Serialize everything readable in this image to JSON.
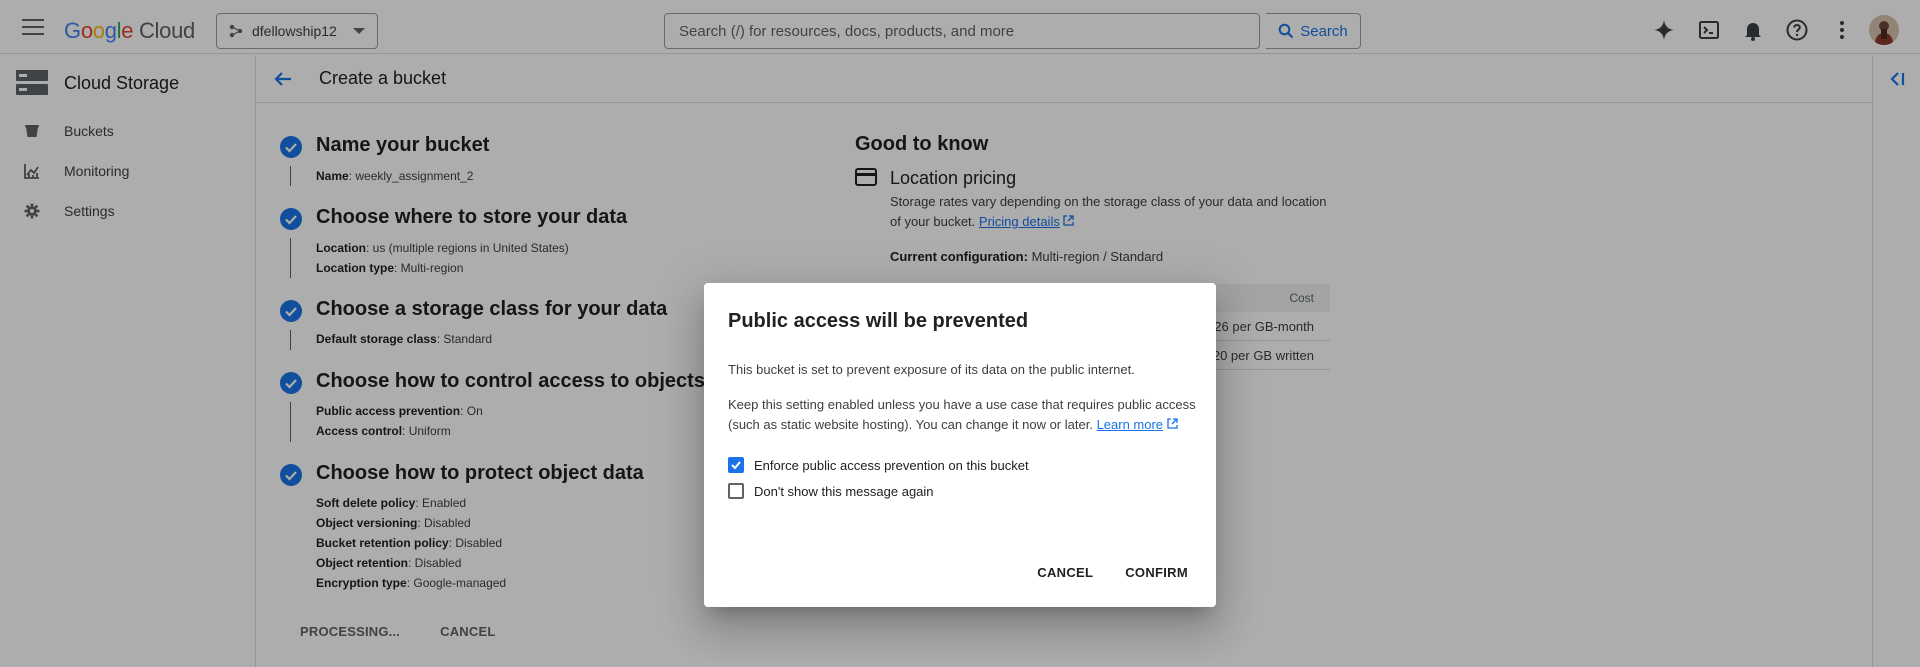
{
  "topbar": {
    "logo": {
      "g1": "G",
      "g2": "o",
      "g3": "o",
      "g4": "g",
      "g5": "l",
      "g6": "e",
      "cloud": "Cloud"
    },
    "project": "dfellowship12",
    "search_placeholder": "Search (/) for resources, docs, products, and more",
    "search_button": "Search",
    "icons": [
      "gemini-icon",
      "cloud-shell-icon",
      "notifications-icon",
      "help-icon",
      "more-vert-icon"
    ]
  },
  "nav": {
    "product_title": "Cloud Storage",
    "items": [
      {
        "label": "Buckets",
        "icon": "bucket-icon"
      },
      {
        "label": "Monitoring",
        "icon": "monitoring-icon"
      },
      {
        "label": "Settings",
        "icon": "gear-icon"
      }
    ]
  },
  "page": {
    "title": "Create a bucket"
  },
  "steps": [
    {
      "title": "Name your bucket",
      "details": [
        {
          "k": "Name",
          "v": ": weekly_assignment_2"
        }
      ]
    },
    {
      "title": "Choose where to store your data",
      "details": [
        {
          "k": "Location",
          "v": ": us (multiple regions in United States)"
        },
        {
          "k": "Location type",
          "v": ": Multi-region"
        }
      ]
    },
    {
      "title": "Choose a storage class for your data",
      "details": [
        {
          "k": "Default storage class",
          "v": ": Standard"
        }
      ]
    },
    {
      "title": "Choose how to control access to objects",
      "details": [
        {
          "k": "Public access prevention",
          "v": ": On"
        },
        {
          "k": "Access control",
          "v": ": Uniform"
        }
      ]
    },
    {
      "title": "Choose how to protect object data",
      "details": [
        {
          "k": "Soft delete policy",
          "v": ": Enabled"
        },
        {
          "k": "Object versioning",
          "v": ": Disabled"
        },
        {
          "k": "Bucket retention policy",
          "v": ": Disabled"
        },
        {
          "k": "Object retention",
          "v": ": Disabled"
        },
        {
          "k": "Encryption type",
          "v": ": Google-managed"
        }
      ]
    }
  ],
  "footer": {
    "processing": "PROCESSING...",
    "cancel": "CANCEL"
  },
  "good_to_know": {
    "title": "Good to know",
    "section": "Location pricing",
    "text_before_link": "Storage rates vary depending on the storage class of your data and location of your bucket.",
    "link": "Pricing details",
    "config_label": "Current configuration:",
    "config_value": "Multi-region / Standard",
    "table_header": "Cost",
    "rows": [
      "26 per GB-month",
      "20 per GB written"
    ]
  },
  "dialog": {
    "title": "Public access will be prevented",
    "p1": "This bucket is set to prevent exposure of its data on the public internet.",
    "p2": "Keep this setting enabled unless you have a use case that requires public access (such as static website hosting). You can change it now or later.",
    "learn_more": "Learn more",
    "checkbox1": {
      "label": "Enforce public access prevention on this bucket",
      "checked": true
    },
    "checkbox2": {
      "label": "Don't show this message again",
      "checked": false
    },
    "cancel": "CANCEL",
    "confirm": "CONFIRM"
  },
  "colors": {
    "accent": "#1a73e8",
    "scrim": "rgba(0,0,0,0.32)"
  }
}
